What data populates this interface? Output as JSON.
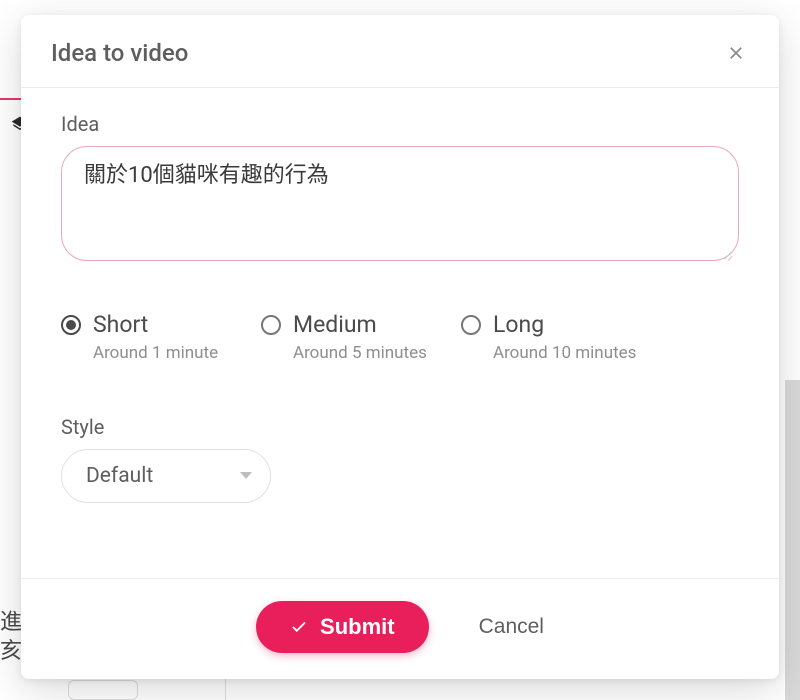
{
  "modal": {
    "title": "Idea to video",
    "idea_label": "Idea",
    "idea_value": "關於10個貓咪有趣的行為",
    "length_options": [
      {
        "label": "Short",
        "sub": "Around 1 minute",
        "selected": true
      },
      {
        "label": "Medium",
        "sub": "Around 5 minutes",
        "selected": false
      },
      {
        "label": "Long",
        "sub": "Around 10 minutes",
        "selected": false
      }
    ],
    "style_label": "Style",
    "style_value": "Default",
    "submit_label": "Submit",
    "cancel_label": "Cancel"
  },
  "background": {
    "partial_text": "進\n亥"
  },
  "colors": {
    "accent": "#e81f5b",
    "textarea_border": "#e8a9b9"
  }
}
